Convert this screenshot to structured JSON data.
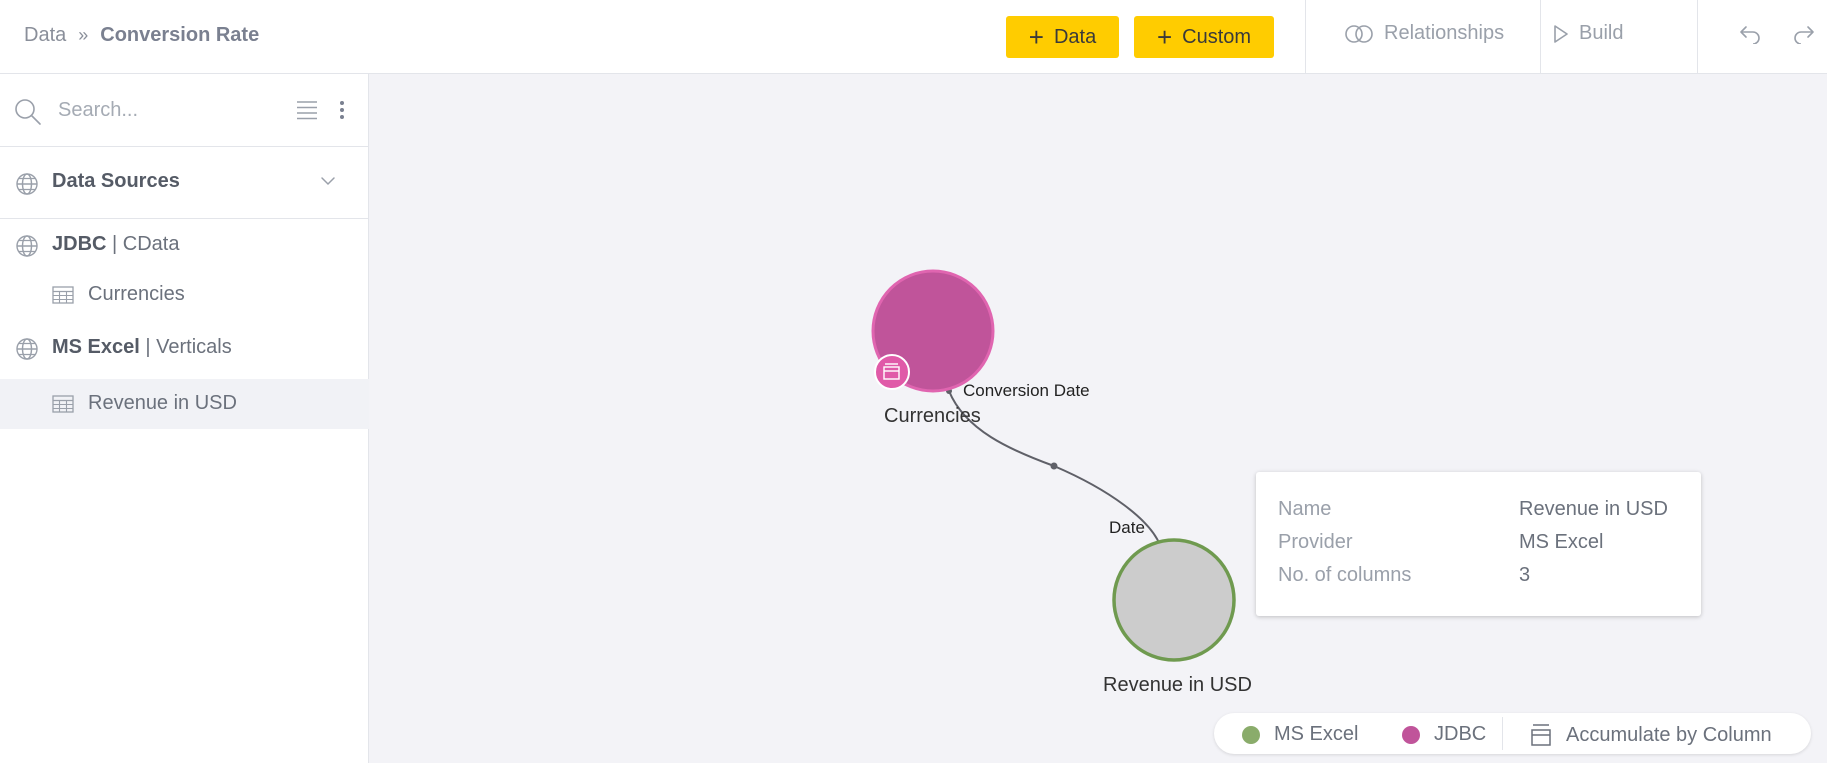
{
  "header": {
    "breadcrumb_root": "Data",
    "breadcrumb_current": "Conversion Rate",
    "add_data_label": "Data",
    "add_custom_label": "Custom",
    "relationships_label": "Relationships",
    "build_label": "Build"
  },
  "sidebar": {
    "search_placeholder": "Search...",
    "data_sources_title": "Data Sources",
    "sources": [
      {
        "type": "JDBC",
        "name": "CData",
        "tables": [
          "Currencies"
        ]
      },
      {
        "type": "MS Excel",
        "name": "Verticals",
        "tables": [
          "Revenue in USD"
        ]
      }
    ],
    "selected_table": "Revenue in USD"
  },
  "canvas": {
    "nodes": [
      {
        "label": "Currencies",
        "provider": "JDBC",
        "color": "#c0549a"
      },
      {
        "label": "Revenue in USD",
        "provider": "MS Excel",
        "color": "#cccccc"
      }
    ],
    "edge": {
      "from_column": "Conversion Date",
      "to_column": "Date"
    },
    "tooltip": {
      "rows": [
        {
          "key": "Name",
          "value": "Revenue in USD"
        },
        {
          "key": "Provider",
          "value": "MS Excel"
        },
        {
          "key": "No. of columns",
          "value": "3"
        }
      ]
    },
    "legend": {
      "items": [
        {
          "label": "MS Excel",
          "color": "#8aac6b"
        },
        {
          "label": "JDBC",
          "color": "#c0549a"
        },
        {
          "label": "Accumulate by Column",
          "icon": "accumulate-icon"
        }
      ]
    }
  },
  "colors": {
    "accent_yellow": "#ffcc00",
    "jdbc_pink": "#c0549a",
    "excel_green": "#6f9a4f"
  }
}
